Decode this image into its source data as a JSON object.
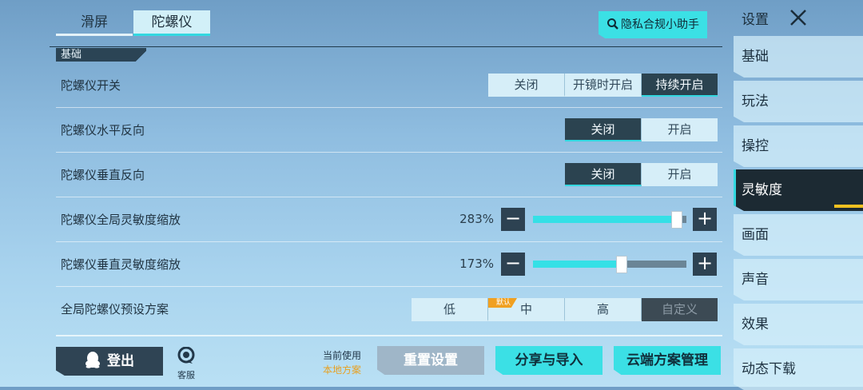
{
  "top_tabs": {
    "slide": "滑屏",
    "gyro": "陀螺仪"
  },
  "privacy_button": "隐私合规小助手",
  "section": {
    "title": "基础"
  },
  "rows": {
    "gyro_switch": {
      "label": "陀螺仪开关",
      "options": [
        "关闭",
        "开镜时开启",
        "持续开启"
      ],
      "selected": "持续开启"
    },
    "gyro_h_invert": {
      "label": "陀螺仪水平反向",
      "options": [
        "关闭",
        "开启"
      ],
      "selected": "关闭"
    },
    "gyro_v_invert": {
      "label": "陀螺仪垂直反向",
      "options": [
        "关闭",
        "开启"
      ],
      "selected": "关闭"
    },
    "global_scale": {
      "label": "陀螺仪全局灵敏度缩放",
      "value_text": "283%",
      "level": 0.94
    },
    "vertical_scale": {
      "label": "陀螺仪垂直灵敏度缩放",
      "value_text": "173%",
      "level": 0.58
    },
    "preset": {
      "label": "全局陀螺仪预设方案",
      "options": [
        "低",
        "中",
        "高",
        "自定义"
      ],
      "default_tag": "默认",
      "default_option": "中",
      "selected": "自定义"
    }
  },
  "stepper": {
    "minus": "−",
    "plus": "+"
  },
  "bottom": {
    "logout": "登出",
    "service": "客服",
    "current_label": "当前使用",
    "current_value": "本地方案",
    "reset": "重置设置",
    "share": "分享与导入",
    "cloud": "云端方案管理"
  },
  "sidebar": {
    "title": "设置",
    "items": [
      "基础",
      "玩法",
      "操控",
      "灵敏度",
      "画面",
      "声音",
      "效果",
      "动态下载"
    ],
    "active": "灵敏度"
  },
  "colors": {
    "accent": "#33d8e0",
    "dark": "#2b4350",
    "tag": "#f0a020"
  }
}
